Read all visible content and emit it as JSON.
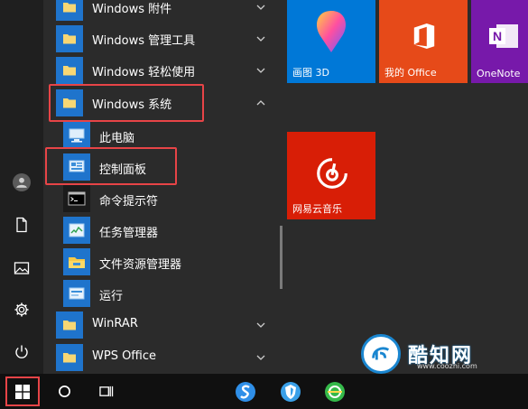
{
  "rail": {
    "icons": [
      "user-icon",
      "document-icon",
      "pictures-icon",
      "gear-icon",
      "power-icon"
    ]
  },
  "applist": {
    "folders_top": [
      {
        "label": "Windows 附件",
        "expanded": false
      },
      {
        "label": "Windows 管理工具",
        "expanded": false
      },
      {
        "label": "Windows 轻松使用",
        "expanded": false
      },
      {
        "label": "Windows 系统",
        "expanded": true
      }
    ],
    "system_apps": [
      {
        "label": "此电脑",
        "icon": "computer-icon"
      },
      {
        "label": "控制面板",
        "icon": "control-panel-icon"
      },
      {
        "label": "命令提示符",
        "icon": "cmd-icon"
      },
      {
        "label": "任务管理器",
        "icon": "task-manager-icon"
      },
      {
        "label": "文件资源管理器",
        "icon": "file-explorer-icon"
      },
      {
        "label": "运行",
        "icon": "run-icon"
      }
    ],
    "folders_bottom": [
      {
        "label": "WinRAR",
        "expanded": false
      },
      {
        "label": "WPS Office",
        "expanded": false
      }
    ]
  },
  "tiles": {
    "paint3d": {
      "label": "画图 3D",
      "color": "#0078d7"
    },
    "office": {
      "label": "我的 Office",
      "color": "#e64a19"
    },
    "onenote": {
      "label": "OneNote",
      "color": "#7719aa"
    },
    "netease": {
      "label": "网易云音乐",
      "color": "#d81e06"
    }
  },
  "taskbar": {
    "icons": [
      "start-icon",
      "cortana-icon",
      "task-view-icon",
      "sogou-browser-icon",
      "shield-browser-icon",
      "360-icon"
    ]
  },
  "watermark": {
    "brand": "酷知网",
    "url": "www.coozhi.com"
  },
  "colors": {
    "accent": "#1f74cc",
    "highlight": "#e74447"
  }
}
